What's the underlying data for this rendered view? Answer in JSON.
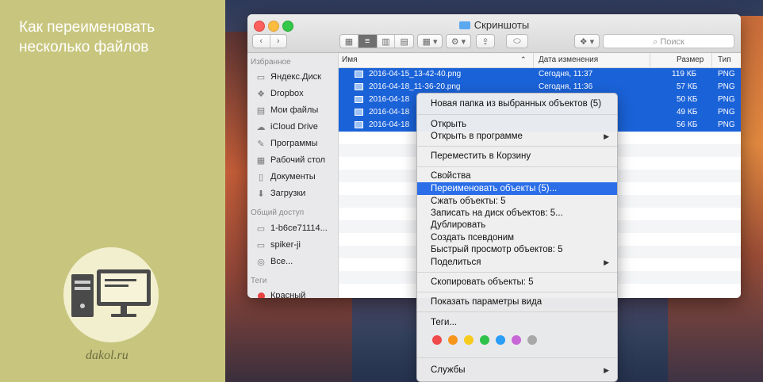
{
  "banner": {
    "title": "Как переименовать несколько файлов",
    "site": "dakol.ru"
  },
  "window": {
    "title": "Скриншоты",
    "search_placeholder": "Поиск",
    "toolbar_icons": [
      "back-icon",
      "forward-icon",
      "icon-view-icon",
      "list-view-icon",
      "column-view-icon",
      "cover-flow-icon",
      "arrange-icon",
      "action-gear-icon",
      "share-icon",
      "tag-icon",
      "dropbox-icon"
    ]
  },
  "sidebar": {
    "favorites_header": "Избранное",
    "favorites": [
      {
        "label": "Яндекс.Диск",
        "icon": "folder-icon"
      },
      {
        "label": "Dropbox",
        "icon": "dropbox-icon"
      },
      {
        "label": "Мои файлы",
        "icon": "files-icon"
      },
      {
        "label": "iCloud Drive",
        "icon": "cloud-icon"
      },
      {
        "label": "Программы",
        "icon": "apps-icon"
      },
      {
        "label": "Рабочий стол",
        "icon": "desktop-icon"
      },
      {
        "label": "Документы",
        "icon": "document-icon"
      },
      {
        "label": "Загрузки",
        "icon": "download-icon"
      }
    ],
    "shared_header": "Общий доступ",
    "shared": [
      {
        "label": "1-b6ce71114...",
        "icon": "computer-icon"
      },
      {
        "label": "spiker-ji",
        "icon": "computer-icon"
      },
      {
        "label": "Все...",
        "icon": "network-icon"
      }
    ],
    "tags_header": "Теги",
    "tags": [
      {
        "label": "Красный",
        "color": "#e94040"
      }
    ]
  },
  "columns": {
    "name": "Имя",
    "date": "Дата изменения",
    "size": "Размер",
    "kind": "Тип"
  },
  "files": [
    {
      "name": "2016-04-15_13-42-40.png",
      "date": "Сегодня, 11:37",
      "size": "119 КБ",
      "kind": "PNG"
    },
    {
      "name": "2016-04-18_11-36-20.png",
      "date": "Сегодня, 11:36",
      "size": "57 КБ",
      "kind": "PNG"
    },
    {
      "name": "2016-04-18",
      "date": "",
      "size": "50 КБ",
      "kind": "PNG"
    },
    {
      "name": "2016-04-18",
      "date": "",
      "size": "49 КБ",
      "kind": "PNG"
    },
    {
      "name": "2016-04-18",
      "date": "",
      "size": "56 КБ",
      "kind": "PNG"
    }
  ],
  "context_menu": {
    "new_folder": "Новая папка из выбранных объектов (5)",
    "open": "Открыть",
    "open_with": "Открыть в программе",
    "move_to_trash": "Переместить в Корзину",
    "get_info": "Свойства",
    "rename": "Переименовать объекты (5)...",
    "compress": "Сжать объекты: 5",
    "burn": "Записать на диск объектов: 5...",
    "duplicate": "Дублировать",
    "make_alias": "Создать псевдоним",
    "quick_look": "Быстрый просмотр объектов: 5",
    "share": "Поделиться",
    "copy": "Скопировать объекты: 5",
    "view_options": "Показать параметры вида",
    "tags": "Теги...",
    "services": "Службы",
    "submenu_arrow": "▶",
    "tag_colors": [
      "#f04b4b",
      "#f7951c",
      "#f5cc1e",
      "#2fc24a",
      "#2a9df4",
      "#c866d8",
      "#a8a8a8"
    ]
  }
}
